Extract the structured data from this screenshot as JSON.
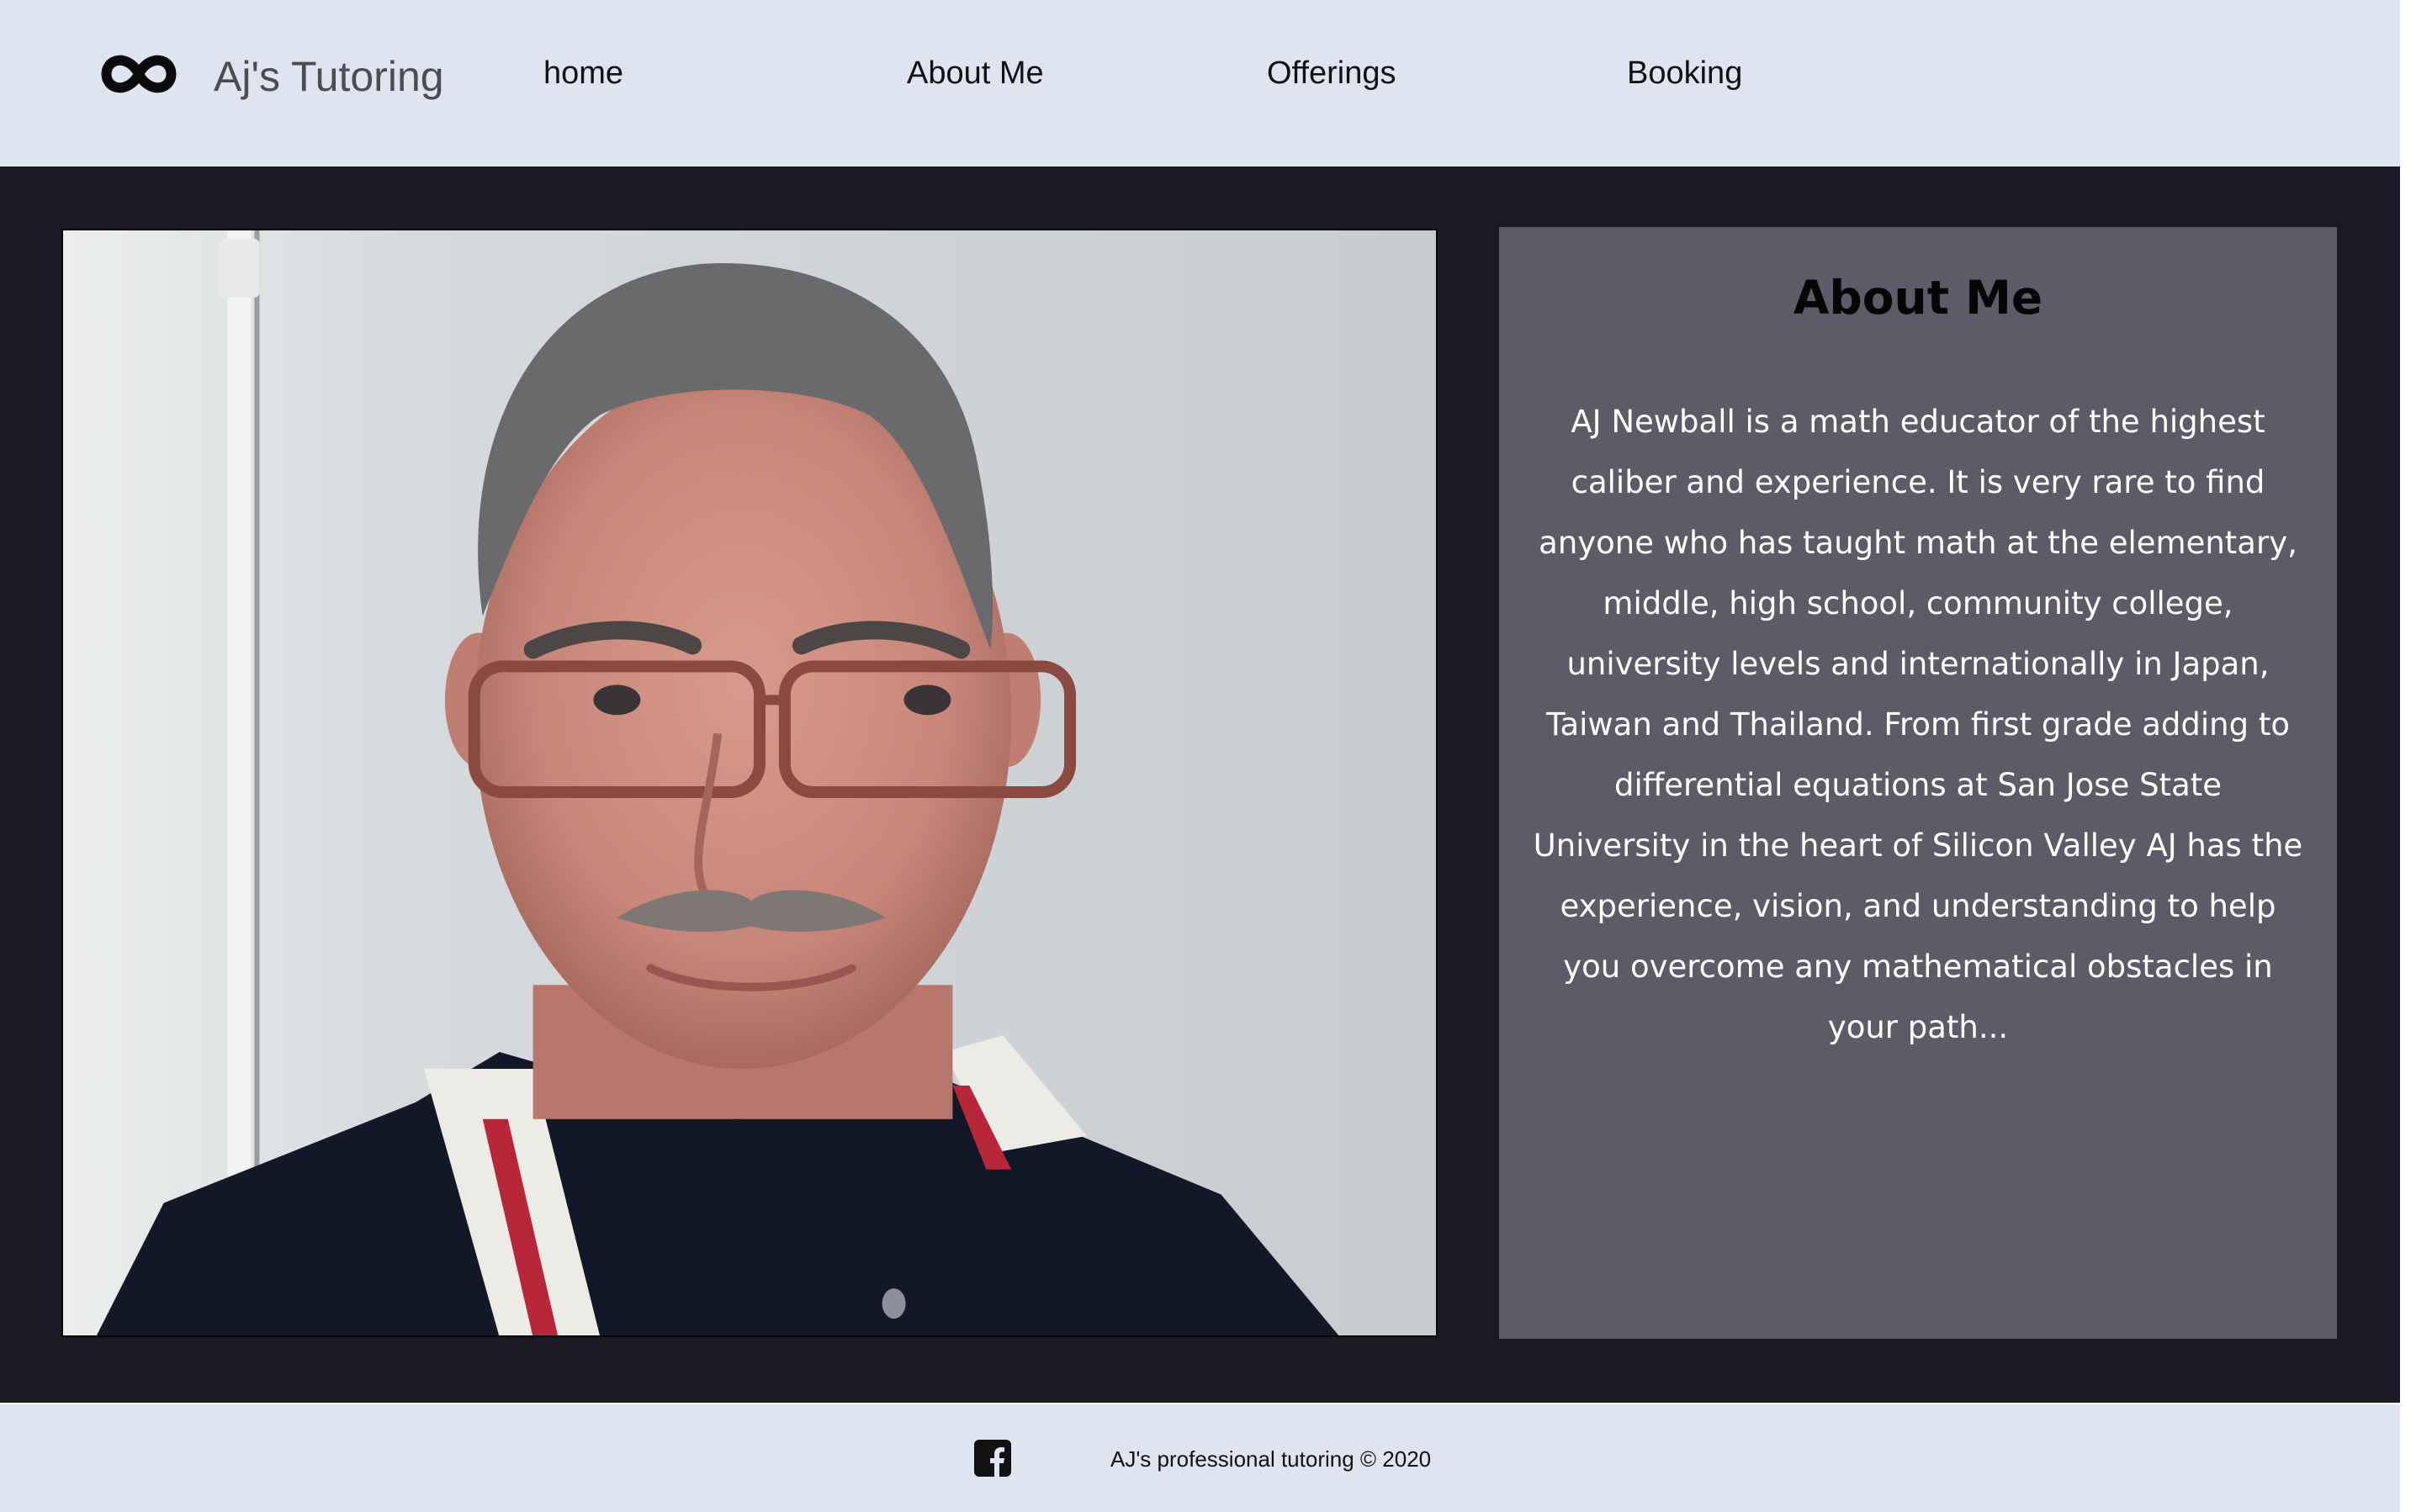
{
  "header": {
    "brand": "Aj's Tutoring",
    "logo_icon": "infinity-icon",
    "nav": [
      {
        "label": "home"
      },
      {
        "label": "About Me"
      },
      {
        "label": "Offerings"
      },
      {
        "label": "Booking"
      }
    ]
  },
  "main": {
    "photo_icon": "portrait-photo",
    "about": {
      "title": "About Me",
      "body": "AJ Newball is a math educator of the highest caliber and experience. It is very rare to find anyone who has taught math at the elementary, middle, high school, community college, university levels and internationally in Japan, Taiwan and Thailand. From first grade adding to differential equations at San Jose State University in the heart of Silicon Valley AJ has the experience, vision, and understanding to help you overcome any mathematical obstacles in your path..."
    }
  },
  "footer": {
    "social_icon": "facebook-icon",
    "copyright": "AJ's professional tutoring © 2020"
  },
  "colors": {
    "header_bg": "#dfe5f0",
    "main_bg": "#1b1a23",
    "panel_bg": "#5d5b68",
    "text_light": "#ffffff",
    "text_dark": "#111111"
  }
}
